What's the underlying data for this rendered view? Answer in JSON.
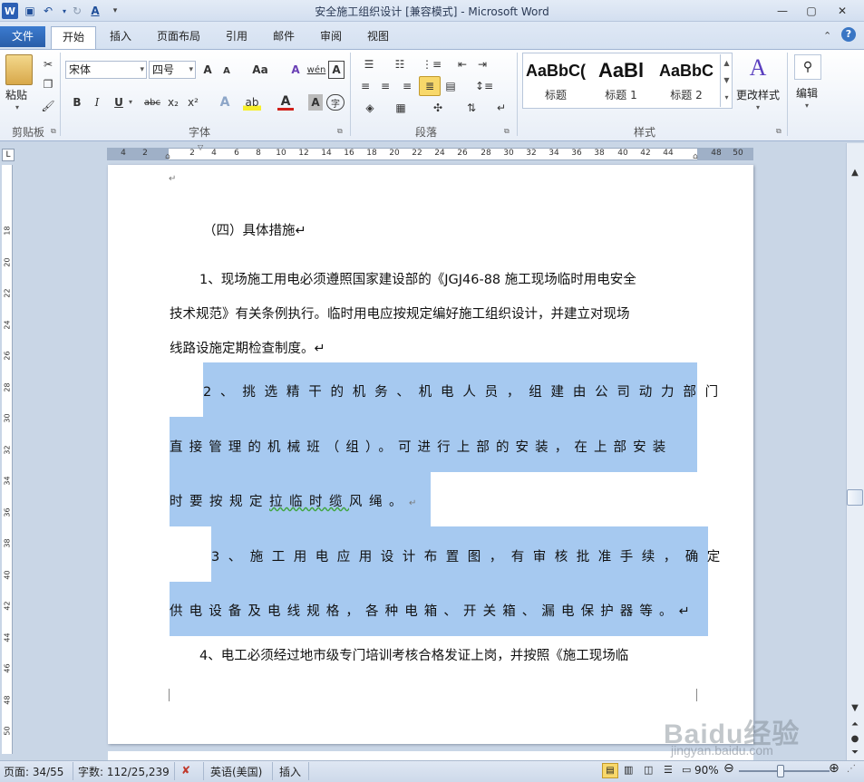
{
  "window": {
    "title": "安全施工组织设计 [兼容模式] - Microsoft Word",
    "app_logo": "W"
  },
  "tabs": {
    "file": "文件",
    "items": [
      "开始",
      "插入",
      "页面布局",
      "引用",
      "邮件",
      "审阅",
      "视图"
    ],
    "active": "开始"
  },
  "ribbon": {
    "clipboard": {
      "paste": "粘贴",
      "group": "剪贴板"
    },
    "font": {
      "font_name": "宋体",
      "font_size": "四号",
      "group": "字体",
      "buttons": {
        "bold": "B",
        "italic": "I",
        "underline": "U",
        "strike": "abc",
        "subscript": "x₂",
        "superscript": "x²",
        "grow": "A",
        "shrink": "A",
        "case": "Aa",
        "clear": "A",
        "phonetic": "wén",
        "charborder": "A",
        "shade": "A",
        "enclose": "字"
      }
    },
    "paragraph": {
      "group": "段落"
    },
    "styles": {
      "group": "样式",
      "items": [
        {
          "sample": "AaBbC(",
          "name": "标题"
        },
        {
          "sample": "AaBl",
          "name": "标题 1"
        },
        {
          "sample": "AaBbC",
          "name": "标题 2"
        }
      ],
      "change": "更改样式"
    },
    "editing": {
      "label": "编辑"
    }
  },
  "ruler": {
    "h_numbers": [
      "4",
      "2",
      "2",
      "4",
      "6",
      "8",
      "10",
      "12",
      "14",
      "16",
      "18",
      "20",
      "22",
      "24",
      "26",
      "28",
      "30",
      "32",
      "34",
      "36",
      "38",
      "40",
      "42",
      "44",
      "48",
      "50"
    ],
    "v_numbers": [
      "18",
      "20",
      "22",
      "24",
      "26",
      "28",
      "30",
      "32",
      "34",
      "36",
      "38",
      "40",
      "42",
      "44",
      "46",
      "48",
      "50"
    ]
  },
  "document": {
    "lines": [
      {
        "text": "↵",
        "style": "mark"
      },
      {
        "text": "（四）具体措施↵",
        "style": "normal"
      },
      {
        "text": "1、现场施工用电必须遵照国家建设部的《JGJ46-88 施工现场临时用电安全",
        "style": "normal"
      },
      {
        "text": "技术规范》有关条例执行。临时用电应按规定编好施工组织设计，并建立对现场",
        "style": "normal"
      },
      {
        "text": "线路设施定期检查制度。↵",
        "style": "normal"
      },
      {
        "text": "2、挑选精干的机务、机电人员，组建由公司动力部门",
        "style": "highlight"
      },
      {
        "text": "直接管理的机械班（组）。可进行上部的安装，在上部安装",
        "style": "highlight"
      },
      {
        "text_before": "时要按规定",
        "text_squiggle": "拉临时缆",
        "text_after": "风绳。",
        "mark": "↵",
        "style": "highlight"
      },
      {
        "text": "3、施工用电应用设计布置图，有审核批准手续，确定",
        "style": "highlight"
      },
      {
        "text": "供电设备及电线规格，各种电箱、开关箱、漏电保护器等。↵",
        "style": "highlight"
      },
      {
        "text": "4、电工必须经过地市级专门培训考核合格发证上岗，并按照《施工现场临",
        "style": "normal"
      }
    ]
  },
  "status": {
    "page": "页面: 34/55",
    "words": "字数: 112/25,239",
    "language": "英语(美国)",
    "mode": "插入",
    "zoom": "90%"
  },
  "watermark": {
    "brand": "Baidu经验",
    "url": "jingyan.baidu.com"
  }
}
